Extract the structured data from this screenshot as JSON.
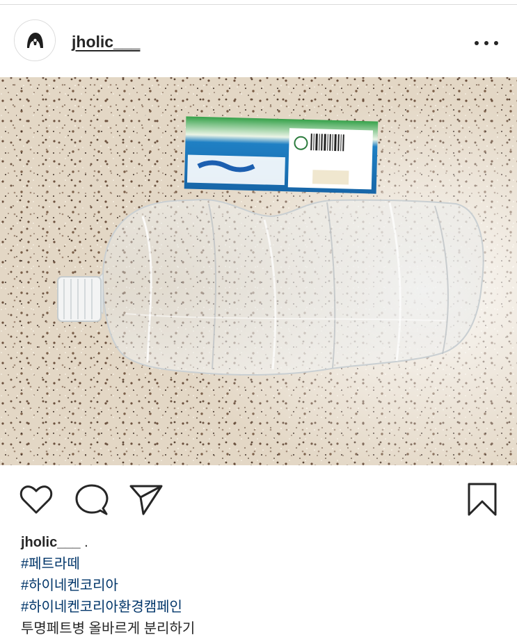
{
  "post": {
    "username": "jholic___",
    "more_icon": "more-horizontal-icon",
    "photo_alt": "flattened plastic bottle"
  },
  "actions": {
    "like_icon": "heart-icon",
    "comment_icon": "comment-icon",
    "share_icon": "send-icon",
    "save_icon": "bookmark-icon"
  },
  "caption": {
    "username": "jholic___",
    "separator": " .",
    "hashtags": [
      "#페트라떼",
      "#하이네켄코리아",
      "#하이네켄코리아환경캠페인"
    ],
    "text": "투명페트병 올바르게 분리하기"
  },
  "colors": {
    "text": "#262626",
    "hashtag": "#003569",
    "divider": "#dbdbdb",
    "label_blue": "#1d7fbf",
    "label_green": "#3aa84a"
  }
}
